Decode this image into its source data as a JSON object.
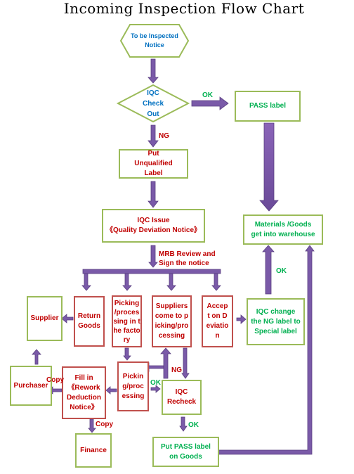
{
  "title": "Incoming Inspection Flow Chart",
  "colors": {
    "arrow": "#7a5aa8",
    "green_border": "#9bbb59",
    "red_border": "#c0504d",
    "green_text": "#00b050",
    "red_text": "#c00000",
    "blue_text": "#0070c0"
  },
  "nodes": {
    "start": "To be Inspected Notice",
    "check": "IQC Check Out",
    "pass_label": "PASS label",
    "unqualified": "Put Unqualified Label",
    "issue_line1": "IQC Issue",
    "issue_line2": "《Quality Deviation Notice》",
    "warehouse": "Materials /Goods get into warehouse",
    "supplier": "Supplier",
    "return_goods": "Return Goods",
    "picking_factory": "Picking /processing in the factory",
    "suppliers_come": "Suppliers come to picking/processing",
    "accept_deviation": "Accept on Deviation",
    "iqc_change": "IQC change the NG label to Special label",
    "purchaser": "Purchaser",
    "rework_notice": "Fill in 《Rework Deduction Notice》",
    "picking_processing": "Picking/processing",
    "iqc_recheck": "IQC Recheck",
    "finance": "Finance",
    "put_pass": "Put PASS label on Goods"
  },
  "edge_labels": {
    "ok_check": "OK",
    "ng_check": "NG",
    "mrb": "MRB Review and Sign the notice",
    "ok_change": "OK",
    "ng_recheck": "NG",
    "ok_picking": "OK",
    "ok_recheck": "OK",
    "copy_purchaser": "Copy",
    "copy_finance": "Copy"
  }
}
